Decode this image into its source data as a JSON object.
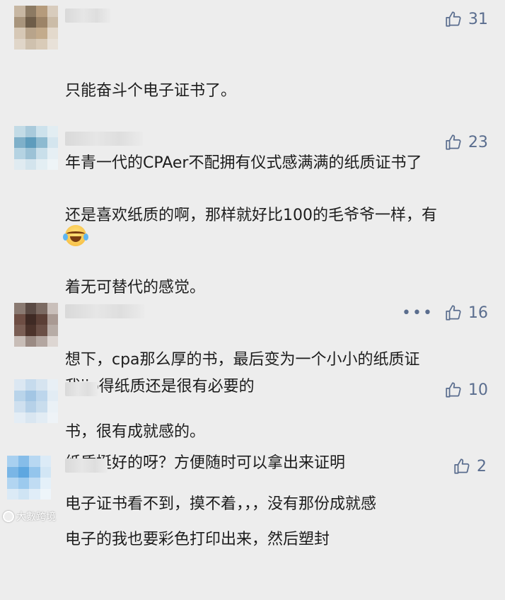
{
  "comments": [
    {
      "likes": "31",
      "lines": [
        "只能奋斗个电子证书了。",
        "年青一代的CPAer不配拥有仪式感满满的纸质证书了"
      ],
      "emoji": "laugh-cry-emoji"
    },
    {
      "likes": "23",
      "lines": [
        "还是喜欢纸质的啊，那样就好比100的毛爷爷一样，有",
        "着无可替代的感觉。",
        "想下，cpa那么厚的书，最后变为一个小小的纸质证",
        "书，很有成就感的。",
        "电子证书看不到，摸不着，，，没有那份成就感"
      ]
    },
    {
      "likes": "16",
      "more": "•••",
      "lines": [
        "我jio得纸质还是很有必要的"
      ]
    },
    {
      "likes": "10",
      "lines": [
        "纸质挺好的呀？方便随时可以拿出来证明"
      ]
    },
    {
      "likes": "2",
      "lines": [
        "电子的我也要彩色打印出来，然后塑封"
      ]
    }
  ],
  "watermark": "大數跨境",
  "colors": {
    "background": "#ededed",
    "like_color": "#5a6d8e",
    "text_color": "#1c1c1c"
  }
}
